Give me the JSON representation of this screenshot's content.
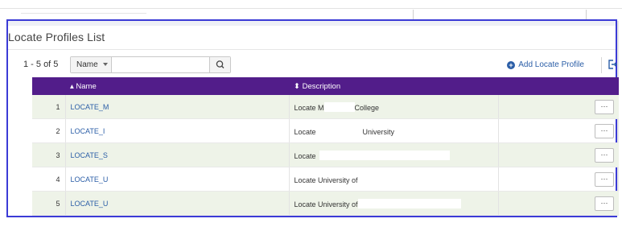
{
  "page": {
    "title": "Locate Profiles List",
    "count_label": "1 - 5 of 5"
  },
  "search": {
    "field_label": "Name",
    "value": "",
    "placeholder": ""
  },
  "toolbar": {
    "add_label": "Add Locate Profile"
  },
  "table": {
    "columns": [
      "",
      "▴ Name",
      "⬍ Description",
      ""
    ],
    "rows": [
      {
        "index": "1",
        "name": "LOCATE_M",
        "desc_start": "Locate M",
        "desc_end": "College"
      },
      {
        "index": "2",
        "name": "LOCATE_I",
        "desc_start": "Locate",
        "desc_end": "University"
      },
      {
        "index": "3",
        "name": "LOCATE_S",
        "desc_start": "Locate",
        "desc_end": ""
      },
      {
        "index": "4",
        "name": "LOCATE_U",
        "desc_start": "Locate University of",
        "desc_end": ""
      },
      {
        "index": "5",
        "name": "LOCATE_U",
        "desc_start": "Locate University of",
        "desc_end": ""
      }
    ],
    "action_label": "···"
  },
  "colors": {
    "header_bg": "#521d8a",
    "link": "#2b5ea7",
    "alt_row": "#eef3e8",
    "frame": "#3b3bd6"
  },
  "icons": [
    "search-icon",
    "plus-circle-icon",
    "export-icon",
    "sort-asc-icon",
    "sort-both-icon",
    "more-actions-icon"
  ]
}
